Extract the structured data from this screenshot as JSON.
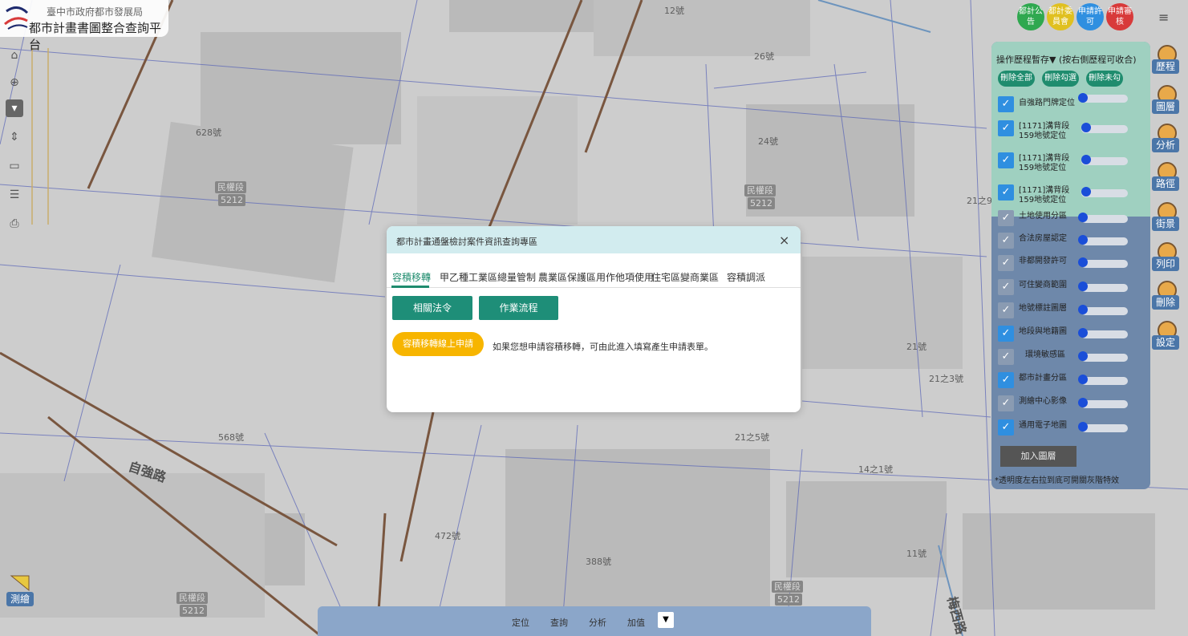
{
  "header": {
    "line1": "臺中市政府都市發展局",
    "line2": "都市計畫書圖整合查詢平台"
  },
  "top_circles": [
    {
      "label": "都計公告",
      "color": "#2fa84f"
    },
    {
      "label": "都計委員會",
      "color": "#e8c820"
    },
    {
      "label": "申請許可",
      "color": "#2f8fe0"
    },
    {
      "label": "申請審核",
      "color": "#d83a3a"
    }
  ],
  "menu_icon": "≡",
  "history": {
    "title": "操作歷程暫存▼ (按右側歷程可收合)",
    "buttons": [
      "刪除全部",
      "刪除勾選",
      "刪除未勾"
    ],
    "items": [
      "自強路門牌定位",
      "[1171]溝背段\n159地號定位",
      "[1171]溝背段\n159地號定位",
      "[1171]溝背段\n159地號定位"
    ]
  },
  "layers": [
    {
      "name": "土地使用分區",
      "checked": false
    },
    {
      "name": "合法房屋認定",
      "checked": false
    },
    {
      "name": "非都開發許可",
      "checked": false
    },
    {
      "name": "可住變商範圍",
      "checked": false
    },
    {
      "name": "地號標註圖層",
      "checked": false
    },
    {
      "name": "地段與地籍圖",
      "checked": true
    },
    {
      "name": "環境敏感區",
      "checked": false
    },
    {
      "name": "都市計畫分區",
      "checked": true
    },
    {
      "name": "測繪中心影像",
      "checked": false
    },
    {
      "name": "通用電子地圖",
      "checked": true
    }
  ],
  "add_layer": "加入圖層",
  "note": "*透明度左右拉到底可開關灰階特效",
  "side_buttons": [
    "歷程",
    "圖層",
    "分析",
    "路徑",
    "街景",
    "列印",
    "刪除",
    "設定"
  ],
  "measure": "測繪",
  "bottom": {
    "items": [
      "定位",
      "查詢",
      "分析",
      "加值"
    ],
    "toggle": "▼"
  },
  "modal": {
    "title": "都市計畫通盤檢討案件資訊查詢專區",
    "close": "×",
    "tabs": [
      "容積移轉",
      "甲乙種工業區總量管制",
      "農業區保護區用作他項使用",
      "住宅區變商業區",
      "容積調派"
    ],
    "buttons": [
      "相關法令",
      "作業流程"
    ],
    "apply": "容積移轉線上申請",
    "desc": "如果您想申請容積移轉，可由此進入填寫產生申請表單。"
  },
  "map_labels": [
    "12號",
    "26號",
    "628號",
    "24號",
    "21之9號",
    "21號",
    "21之3號",
    "568號",
    "21之5號",
    "14之1號",
    "472號",
    "388號",
    "11號"
  ],
  "parcels": [
    "民權段",
    "5212",
    "民權段",
    "5212",
    "民權段",
    "5212",
    "民權段",
    "5212"
  ],
  "roads": [
    "自強路",
    "梅西路"
  ]
}
